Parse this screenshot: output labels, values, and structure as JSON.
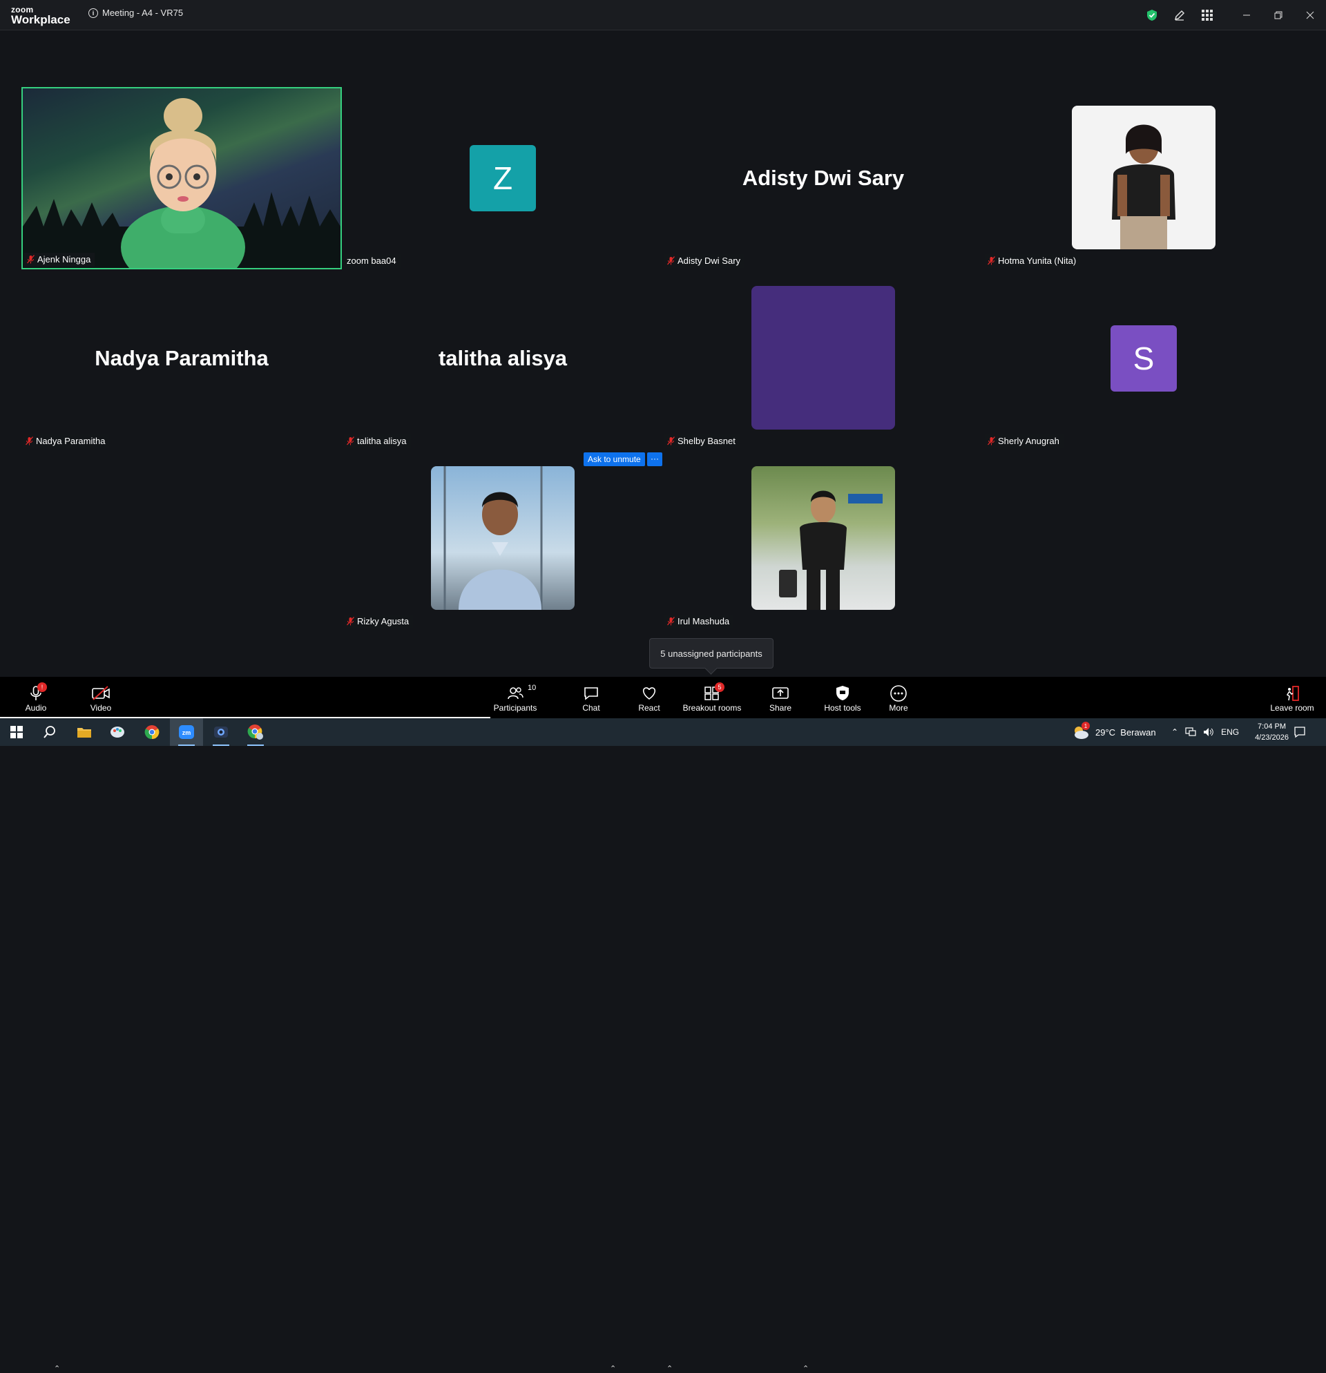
{
  "titlebar": {
    "brand_small": "zoom",
    "brand_large": "Workplace",
    "meeting_title": "Meeting - A4 - VR75"
  },
  "tiles": [
    {
      "name": "Ajenk Ningga",
      "kind": "video",
      "muted": true
    },
    {
      "name": "zoom baa04",
      "kind": "letter",
      "letter": "Z",
      "color": "#14a1a8",
      "muted": false
    },
    {
      "name": "Adisty Dwi Sary",
      "kind": "name",
      "big": "Adisty Dwi Sary",
      "muted": true
    },
    {
      "name": "Hotma Yunita (Nita)",
      "kind": "photo",
      "muted": true
    },
    {
      "name": "Nadya Paramitha",
      "kind": "name",
      "big": "Nadya Paramitha",
      "muted": true
    },
    {
      "name": "talitha alisya",
      "kind": "name",
      "big": "talitha alisya",
      "muted": true
    },
    {
      "name": "Shelby Basnet",
      "kind": "solid",
      "color": "#452d7c",
      "muted": true
    },
    {
      "name": "Sherly Anugrah",
      "kind": "letter",
      "letter": "S",
      "color": "#7a4fc2",
      "muted": true
    },
    {
      "name": "Rizky Agusta",
      "kind": "photo",
      "muted": true
    },
    {
      "name": "Irul Mashuda",
      "kind": "photo",
      "muted": true
    }
  ],
  "hover_actions": {
    "ask_unmute": "Ask to unmute",
    "more": "···"
  },
  "tooltip": "5 unassigned participants",
  "toolbar": {
    "audio": "Audio",
    "video": "Video",
    "participants": "Participants",
    "participants_count": "10",
    "chat": "Chat",
    "react": "React",
    "breakout": "Breakout rooms",
    "breakout_badge": "5",
    "share": "Share",
    "host_tools": "Host tools",
    "more": "More",
    "leave": "Leave room"
  },
  "taskbar": {
    "weather": "29°C  Berawan",
    "weather_badge": "1",
    "lang": "ENG",
    "time": "7:04 PM",
    "date": "4/23/2026"
  },
  "colors": {
    "active_speaker": "#35d07f",
    "accent": "#0e72ed",
    "muted_red": "#e02828"
  }
}
